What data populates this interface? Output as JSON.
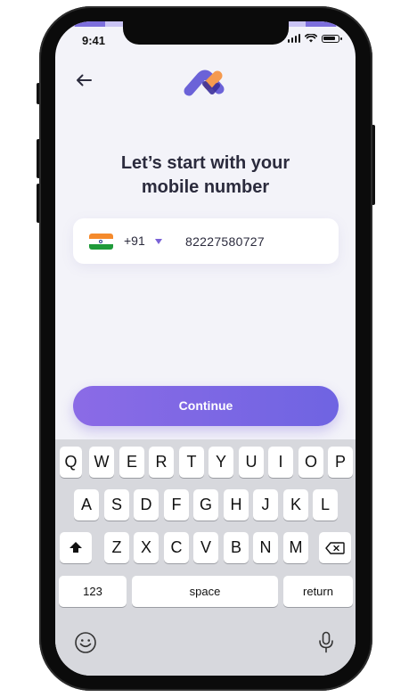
{
  "status_bar": {
    "time": "9:41"
  },
  "header": {
    "back_icon": "arrow-left-icon",
    "logo_icon": "brand-logo"
  },
  "heading": {
    "line1": "Let’s start with your",
    "line2": "mobile number"
  },
  "phone_field": {
    "country_flag": "india-flag-icon",
    "country_code": "+91",
    "value": "82227580727"
  },
  "continue_button": {
    "label": "Continue"
  },
  "colors": {
    "accent": "#7a62d6",
    "button_start": "#8b6be6",
    "button_end": "#6f64e2",
    "background": "#f3f3f9",
    "heading": "#2b2b3d"
  },
  "keyboard": {
    "row1": [
      "Q",
      "W",
      "E",
      "R",
      "T",
      "Y",
      "U",
      "I",
      "O",
      "P"
    ],
    "row2": [
      "A",
      "S",
      "D",
      "F",
      "G",
      "H",
      "J",
      "K",
      "L"
    ],
    "row3": [
      "Z",
      "X",
      "C",
      "V",
      "B",
      "N",
      "M"
    ],
    "shift_icon": "shift-icon",
    "delete_icon": "backspace-icon",
    "numbers_label": "123",
    "space_label": "space",
    "return_label": "return",
    "emoji_icon": "emoji-icon",
    "mic_icon": "microphone-icon"
  }
}
